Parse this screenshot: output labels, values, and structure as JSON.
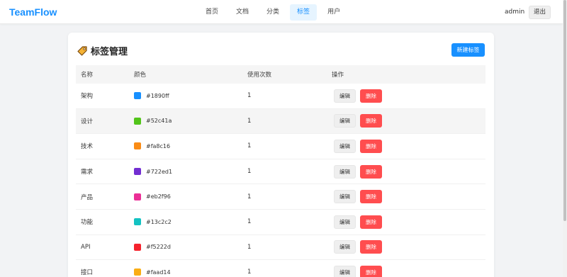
{
  "app": {
    "logo": "TeamFlow"
  },
  "nav": [
    {
      "label": "首页",
      "active": false
    },
    {
      "label": "文档",
      "active": false
    },
    {
      "label": "分类",
      "active": false
    },
    {
      "label": "标签",
      "active": true
    },
    {
      "label": "用户",
      "active": false
    }
  ],
  "user": {
    "name": "admin",
    "logout_label": "退出"
  },
  "page": {
    "title": "标签管理",
    "new_button": "新建标签",
    "title_icon": "tag-icon"
  },
  "table": {
    "headers": {
      "name": "名称",
      "color": "颜色",
      "count": "使用次数",
      "ops": "操作"
    },
    "edit_label": "编辑",
    "delete_label": "删除",
    "rows": [
      {
        "name": "架构",
        "color": "#1890ff",
        "count": "1"
      },
      {
        "name": "设计",
        "color": "#52c41a",
        "count": "1"
      },
      {
        "name": "技术",
        "color": "#fa8c16",
        "count": "1"
      },
      {
        "name": "需求",
        "color": "#722ed1",
        "count": "1"
      },
      {
        "name": "产品",
        "color": "#eb2f96",
        "count": "1"
      },
      {
        "name": "功能",
        "color": "#13c2c2",
        "count": "1"
      },
      {
        "name": "API",
        "color": "#f5222d",
        "count": "1"
      },
      {
        "name": "接口",
        "color": "#faad14",
        "count": "1"
      }
    ]
  },
  "colors": {
    "accent": "#1890ff",
    "danger": "#ff4d4f",
    "highlight_row": "#f5f5f5"
  }
}
